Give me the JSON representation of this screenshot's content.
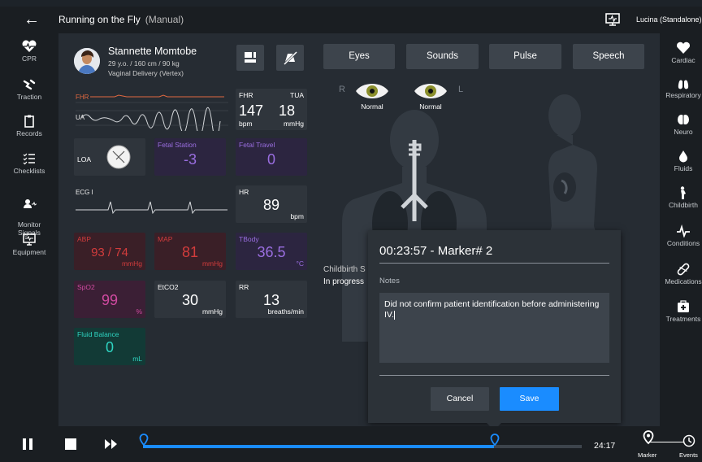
{
  "header": {
    "back_icon": "arrow-left-icon",
    "title": "Running on the Fly",
    "mode": "(Manual)",
    "user": "Lucina (Standalone)"
  },
  "left_sidebar": {
    "items": [
      {
        "label": "CPR",
        "icon": "heart-pulse-icon"
      },
      {
        "label": "Traction",
        "icon": "traction-icon"
      },
      {
        "label": "Records",
        "icon": "clipboard-icon"
      },
      {
        "label": "Checklists",
        "icon": "checklist-icon"
      },
      {
        "label": "Monitor\nSignals",
        "icon": "monitor-signals-icon"
      },
      {
        "label": "Equipment",
        "icon": "equipment-icon"
      }
    ]
  },
  "right_sidebar": {
    "items": [
      {
        "label": "Cardiac",
        "icon": "heart-icon"
      },
      {
        "label": "Respiratory",
        "icon": "lungs-icon"
      },
      {
        "label": "Neuro",
        "icon": "brain-icon"
      },
      {
        "label": "Fluids",
        "icon": "drop-icon"
      },
      {
        "label": "Childbirth",
        "icon": "childbirth-icon"
      },
      {
        "label": "Conditions",
        "icon": "conditions-icon"
      },
      {
        "label": "Medications",
        "icon": "pill-icon"
      },
      {
        "label": "Treatments",
        "icon": "first-aid-icon"
      }
    ]
  },
  "patient": {
    "name": "Stannette Momtobe",
    "info": "29 y.o. / 160 cm / 90 kg",
    "delivery": "Vaginal Delivery (Vertex)"
  },
  "tabs": [
    "Eyes",
    "Sounds",
    "Pulse",
    "Speech"
  ],
  "eyes": {
    "r_label": "R",
    "l_label": "L",
    "right": "Normal",
    "left": "Normal"
  },
  "waveforms": {
    "fhr": "FHR",
    "ua": "UA",
    "ecg": "ECG I"
  },
  "vitals": {
    "fhr": {
      "label": "FHR",
      "value": "147",
      "unit": "bpm"
    },
    "tua": {
      "label": "TUA",
      "value": "18",
      "unit": "mmHg"
    },
    "loa": {
      "label": "LOA"
    },
    "fetal_station": {
      "label": "Fetal Station",
      "value": "-3"
    },
    "fetal_travel": {
      "label": "Fetal Travel",
      "value": "0"
    },
    "hr": {
      "label": "HR",
      "value": "89",
      "unit": "bpm"
    },
    "abp": {
      "label": "ABP",
      "value": "93 / 74",
      "unit": "mmHg"
    },
    "map": {
      "label": "MAP",
      "value": "81",
      "unit": "mmHg"
    },
    "tbody": {
      "label": "TBody",
      "value": "36.5",
      "unit": "°C"
    },
    "spo2": {
      "label": "SpO2",
      "value": "99",
      "unit": "%"
    },
    "etco2": {
      "label": "EtCO2",
      "value": "30",
      "unit": "mmHg"
    },
    "rr": {
      "label": "RR",
      "value": "13",
      "unit": "breaths/min"
    },
    "fluid": {
      "label": "Fluid Balance",
      "value": "0",
      "unit": "mL"
    }
  },
  "childbirth_status": {
    "label": "Childbirth S",
    "value": "In progress"
  },
  "dialog": {
    "title": "00:23:57 - Marker# 2",
    "notes_label": "Notes",
    "notes_value": "Did not confirm patient identification before administering IV.",
    "cancel": "Cancel",
    "save": "Save"
  },
  "bottom": {
    "time": "24:17",
    "marker_label": "Marker",
    "events_label": "Events",
    "progress": 0.8
  },
  "colors": {
    "accent": "#1a8cff",
    "abp_tile": "#3a1f27",
    "spo2_tile": "#3b1f35",
    "fetal_tile": "#2c2540",
    "fluid_tile": "#123a36",
    "panel": "#2f353c"
  }
}
